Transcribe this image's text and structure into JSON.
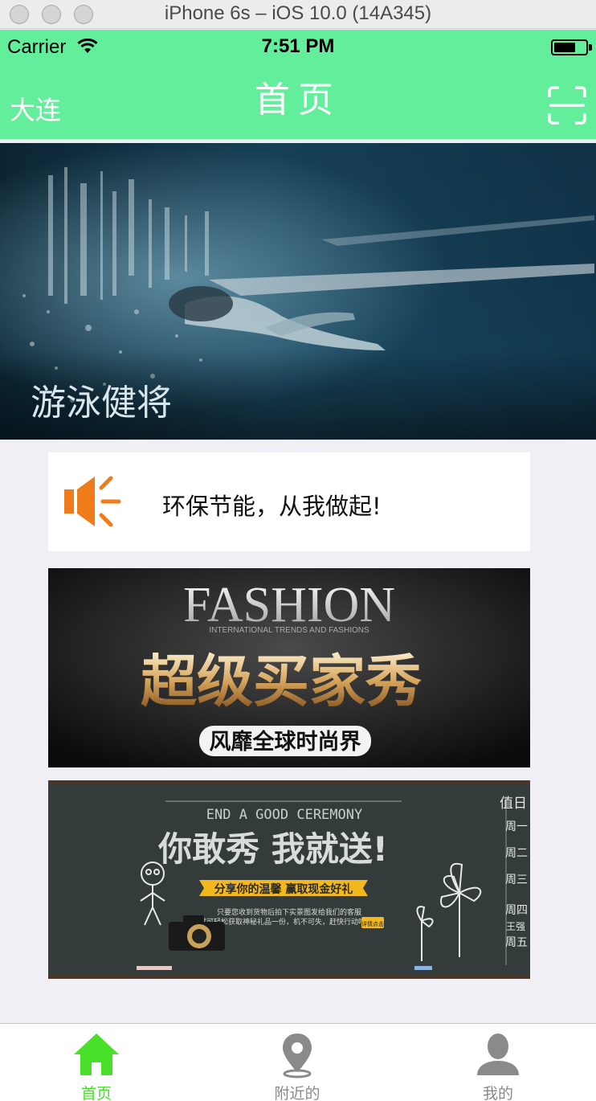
{
  "simulator": {
    "title": "iPhone 6s – iOS 10.0 (14A345)"
  },
  "status_bar": {
    "carrier": "Carrier",
    "time": "7:51 PM"
  },
  "nav": {
    "city": "大连",
    "title": "首页"
  },
  "banner": {
    "caption": "游泳健将"
  },
  "notice": {
    "text": "环保节能，从我做起!"
  },
  "ad1": {
    "headline": "FASHION",
    "subline": "INTERNATIONAL TRENDS AND FASHIONS",
    "title": "超级买家秀",
    "tag": "风靡全球时尚界"
  },
  "ad2": {
    "headline": "END A GOOD CEREMONY",
    "title": "你敢秀 我就送!",
    "ribbon": "分享你的温馨 赢取现金好礼",
    "body1": "只要您收到货物后拍下实景图发给我们的客服",
    "body2": "就可轻松获取神秘礼品一份，机不可失，赶快行动吧！",
    "button": "详情点击",
    "board_lines": [
      "值日",
      "周一",
      "周二",
      "周三",
      "周四",
      "周五"
    ],
    "board_names": "王强"
  },
  "tabs": [
    {
      "label": "首页",
      "icon": "home-icon",
      "active": true
    },
    {
      "label": "附近的",
      "icon": "location-pin-icon",
      "active": false
    },
    {
      "label": "我的",
      "icon": "person-icon",
      "active": false
    }
  ],
  "colors": {
    "nav_green": "#63ee9b",
    "active_tab": "#49e02a",
    "inactive_tab": "#8a8a8a",
    "speaker_orange": "#f07b1a"
  }
}
